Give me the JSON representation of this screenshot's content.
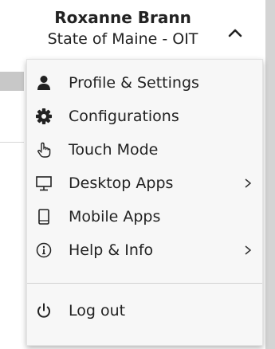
{
  "account": {
    "user_name": "Roxanne Brann",
    "organization": "State of Maine - OIT"
  },
  "menu": {
    "items": [
      {
        "label": "Profile & Settings",
        "icon": "user-icon"
      },
      {
        "label": "Configurations",
        "icon": "gear-icon"
      },
      {
        "label": "Touch Mode",
        "icon": "touch-hand-icon"
      },
      {
        "label": "Desktop Apps",
        "icon": "monitor-icon",
        "has_submenu": true
      },
      {
        "label": "Mobile Apps",
        "icon": "mobile-icon"
      },
      {
        "label": "Help & Info",
        "icon": "info-icon",
        "has_submenu": true
      }
    ],
    "logout": {
      "label": "Log out",
      "icon": "power-icon"
    }
  },
  "colors": {
    "menu_background": "#f7f7f7",
    "text": "#222222",
    "scrollbar": "#d4d4d4"
  }
}
